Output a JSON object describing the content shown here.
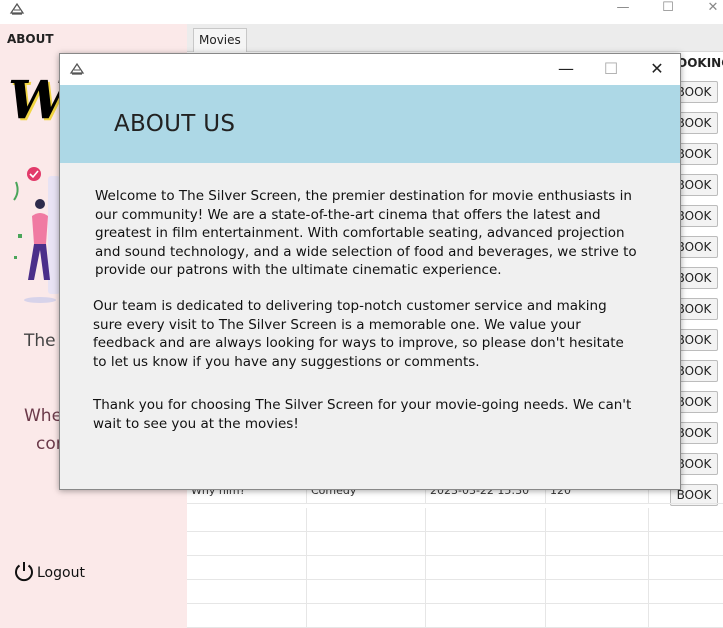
{
  "outer_window": {
    "minimize": "—",
    "maximize": "☐",
    "close": "✕"
  },
  "sidebar": {
    "section_label": "ABOUT",
    "logo_text": "W",
    "text_line_1": "The S",
    "text_line_2": "Whe",
    "text_line_3": "cor",
    "logout_label": "Logout"
  },
  "content": {
    "tab_label": "Movies",
    "column_header": "OOKING",
    "book_label": "BOOK",
    "book_count": 14,
    "visible_row": {
      "title": "Why him?",
      "genre": "Comedy",
      "datetime": "2023-03-22 15:30",
      "duration": "120"
    }
  },
  "dialog": {
    "minimize": "—",
    "maximize": "☐",
    "close": "✕",
    "title": "ABOUT US",
    "paragraph_1": "Welcome to The Silver Screen, the premier destination for movie enthusiasts in our community! We are a state-of-the-art cinema that offers the latest and greatest in film entertainment. With comfortable seating, advanced projection and sound technology, and a wide selection of food and beverages, we strive to provide our patrons with the ultimate cinematic experience.",
    "paragraph_2": "Our team is dedicated to delivering top-notch customer service and making sure every visit to The Silver Screen is a memorable one. We value your feedback and are always looking for ways to improve, so please don't hesitate to let us know if you have any suggestions or comments.",
    "paragraph_3": "Thank you for choosing The Silver Screen for your movie-going needs. We can't wait to see you at the movies!"
  },
  "colors": {
    "sidebar_bg": "#fbe9e9",
    "dialog_header_bg": "#add8e6",
    "dialog_body_bg": "#f0f0f0"
  }
}
